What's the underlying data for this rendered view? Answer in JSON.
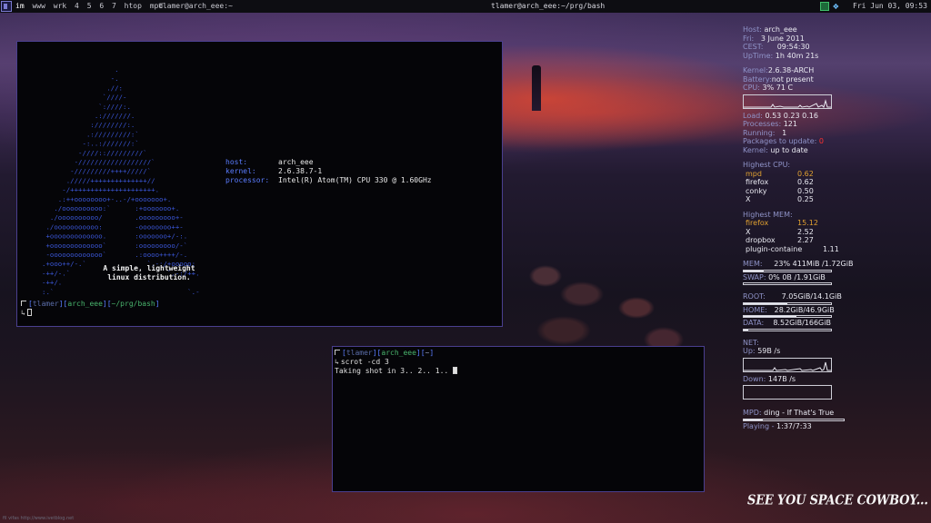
{
  "topbar": {
    "tags": [
      "im",
      "www",
      "wrk",
      "4",
      "5",
      "6",
      "7",
      "htop",
      "mpd"
    ],
    "active_tag": "im",
    "left_title": "tlamer@arch_eee:~",
    "window_title": "tlamer@arch_eee:~/prg/bash",
    "clock": "Fri Jun 03, 09:53",
    "tray_icons": [
      "network-icon",
      "dropbox-icon"
    ]
  },
  "terminal1": {
    "arch_logo_lines": [
      "                  .",
      "                 -.",
      "                .//:",
      "               `////-",
      "              `:////:.",
      "             .:///////.",
      "            :////////:.",
      "           .://///////:`",
      "          -:..:///////:`",
      "         -////:://///////`",
      "        -//////////////////`",
      "       -/////////++++/////`",
      "      ./////++++++++++++++//",
      "     -/+++++++++++++++++++++.",
      "    .:++oooooooo+-..-/+ooooooo+.",
      "   ./oooooooooo:`      :+ooooooo+.",
      "  ./oooooooooo/        .ooooooooo+-",
      " ./ooooooooooo:        -oooooooo++-",
      " +ooooooooooooo.       :ooooooo+/-:.",
      " +ooooooooooooo`       :ooooooooo/-`",
      " -ooooooooooooo`       .:oooo++++/-.",
      ".+ooo++/-.`               `.-:/+ooooo:",
      "-++/-.`                        `.-:/++.",
      "-++/.   ",
      ":.`                                 `.-"
    ],
    "info": [
      {
        "key": "host:",
        "value": "arch_eee"
      },
      {
        "key": "kernel:",
        "value": "2.6.38.7-1"
      },
      {
        "key": "processor:",
        "value": "Intel(R) Atom(TM) CPU 330 @ 1.60GHz"
      }
    ],
    "tagline_1": "A simple, lightweight",
    "tagline_2": "linux distribution.",
    "prompt": {
      "user": "tlamer",
      "host": "arch_eee",
      "path": "~/prg/bash"
    }
  },
  "terminal2": {
    "prompt": {
      "user": "tlamer",
      "host": "arch_eee",
      "path": "~"
    },
    "command": "scrot -cd 3",
    "output": "Taking shot in 3.. 2.. 1.. "
  },
  "conky": {
    "host": {
      "label": "Host:",
      "value": "arch_eee"
    },
    "date": {
      "label": "Fri:",
      "value": "3 June 2011"
    },
    "time": {
      "label": "CEST:",
      "value": "09:54:30"
    },
    "uptime": {
      "label": "UpTime:",
      "value": "1h 40m 21s"
    },
    "kernel": {
      "label": "Kernel:",
      "value": "2.6.38-ARCH"
    },
    "battery": {
      "label": "Battery:",
      "value": "not present"
    },
    "cpu": {
      "label": "CPU:",
      "value": "3% 71 C"
    },
    "load": {
      "label": "Load:",
      "value": "0.53 0.23 0.16"
    },
    "processes": {
      "label": "Processes:",
      "value": "121"
    },
    "running": {
      "label": "Running:",
      "value": "1"
    },
    "packages": {
      "label": "Packages to update:",
      "value": "0"
    },
    "kernel_status": {
      "label": "Kernel:",
      "value": "up to date"
    },
    "highest_cpu_title": "Highest CPU:",
    "highest_cpu": [
      {
        "name": "mpd",
        "value": "0.62"
      },
      {
        "name": "firefox",
        "value": "0.62"
      },
      {
        "name": "conky",
        "value": "0.50"
      },
      {
        "name": "X",
        "value": "0.25"
      }
    ],
    "highest_mem_title": "Highest MEM:",
    "highest_mem": [
      {
        "name": "firefox",
        "value": "15.12"
      },
      {
        "name": "X",
        "value": "2.52"
      },
      {
        "name": "dropbox",
        "value": "2.27"
      },
      {
        "name": "plugin-containe",
        "value": "1.11"
      }
    ],
    "mem": {
      "label": "MEM:",
      "value": "23% 411MiB /1.72GiB",
      "fraction": 0.23
    },
    "swap": {
      "label": "SWAP:",
      "value": "0% 0B  /1.91GiB",
      "fraction": 0.0
    },
    "root": {
      "label": "ROOT:",
      "value": "7.05GiB/14.1GiB",
      "fraction": 0.5
    },
    "home": {
      "label": "HOME:",
      "value": "28.2GiB/46.9GiB",
      "fraction": 0.6
    },
    "data": {
      "label": "DATA:",
      "value": "8.52GiB/166GiB",
      "fraction": 0.05
    },
    "net_title": "NET:",
    "up": {
      "label": "Up:",
      "value": "59B  /s"
    },
    "down": {
      "label": "Down:",
      "value": "147B /s"
    },
    "mpd": {
      "label": "MPD:",
      "value": "ding - If That's True",
      "fraction": 0.19
    },
    "playing": {
      "label": "Playing -",
      "value": "1:37/7:33"
    }
  },
  "slogan": "SEE YOU SPACE COWBOY...",
  "watermark": "fil vifas http://www.ivetblog.net"
}
